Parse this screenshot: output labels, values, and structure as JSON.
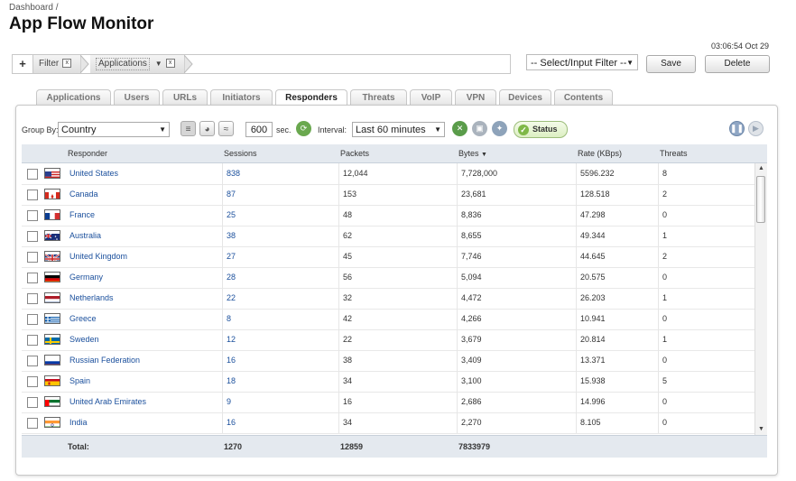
{
  "breadcrumb": "Dashboard /",
  "title": "App Flow Monitor",
  "timestamp": "03:06:54 Oct 29",
  "filter_bar": {
    "plus": "+",
    "filter_label": "Filter",
    "applications_label": "Applications",
    "close": "x",
    "chevron": "▼"
  },
  "select_filter": {
    "value": "-- Select/Input Filter --",
    "chevron": "▼"
  },
  "buttons": {
    "save": "Save",
    "delete": "Delete"
  },
  "tabs": [
    {
      "label": "Applications",
      "active": false
    },
    {
      "label": "Users",
      "active": false
    },
    {
      "label": "URLs",
      "active": false
    },
    {
      "label": "Initiators",
      "active": false
    },
    {
      "label": "Responders",
      "active": true
    },
    {
      "label": "Threats",
      "active": false
    },
    {
      "label": "VoIP",
      "active": false
    },
    {
      "label": "VPN",
      "active": false
    },
    {
      "label": "Devices",
      "active": false
    },
    {
      "label": "Contents",
      "active": false
    }
  ],
  "toolbar": {
    "group_by_label": "Group By:",
    "group_by_value": "Country",
    "group_by_chevron": "▼",
    "refresh_value": "600",
    "sec_label": "sec.",
    "interval_label": "Interval:",
    "interval_value": "Last 60 minutes",
    "interval_chevron": "▼",
    "status_label": "Status"
  },
  "table": {
    "columns": [
      "Responder",
      "Sessions",
      "Packets",
      "Bytes",
      "Rate (KBps)",
      "Threats"
    ],
    "sort_indicator": "▼",
    "rows": [
      {
        "flag": "us",
        "responder": "United States",
        "sessions": "838",
        "packets": "12,044",
        "bytes": "7,728,000",
        "rate": "5596.232",
        "threats": "8"
      },
      {
        "flag": "ca",
        "responder": "Canada",
        "sessions": "87",
        "packets": "153",
        "bytes": "23,681",
        "rate": "128.518",
        "threats": "2"
      },
      {
        "flag": "fr",
        "responder": "France",
        "sessions": "25",
        "packets": "48",
        "bytes": "8,836",
        "rate": "47.298",
        "threats": "0"
      },
      {
        "flag": "au",
        "responder": "Australia",
        "sessions": "38",
        "packets": "62",
        "bytes": "8,655",
        "rate": "49.344",
        "threats": "1"
      },
      {
        "flag": "gb",
        "responder": "United Kingdom",
        "sessions": "27",
        "packets": "45",
        "bytes": "7,746",
        "rate": "44.645",
        "threats": "2"
      },
      {
        "flag": "de",
        "responder": "Germany",
        "sessions": "28",
        "packets": "56",
        "bytes": "5,094",
        "rate": "20.575",
        "threats": "0"
      },
      {
        "flag": "nl",
        "responder": "Netherlands",
        "sessions": "22",
        "packets": "32",
        "bytes": "4,472",
        "rate": "26.203",
        "threats": "1"
      },
      {
        "flag": "gr",
        "responder": "Greece",
        "sessions": "8",
        "packets": "42",
        "bytes": "4,266",
        "rate": "10.941",
        "threats": "0"
      },
      {
        "flag": "se",
        "responder": "Sweden",
        "sessions": "12",
        "packets": "22",
        "bytes": "3,679",
        "rate": "20.814",
        "threats": "1"
      },
      {
        "flag": "ru",
        "responder": "Russian Federation",
        "sessions": "16",
        "packets": "38",
        "bytes": "3,409",
        "rate": "13.371",
        "threats": "0"
      },
      {
        "flag": "es",
        "responder": "Spain",
        "sessions": "18",
        "packets": "34",
        "bytes": "3,100",
        "rate": "15.938",
        "threats": "5"
      },
      {
        "flag": "ae",
        "responder": "United Arab Emirates",
        "sessions": "9",
        "packets": "16",
        "bytes": "2,686",
        "rate": "14.996",
        "threats": "0"
      },
      {
        "flag": "in",
        "responder": "India",
        "sessions": "16",
        "packets": "34",
        "bytes": "2,270",
        "rate": "8.105",
        "threats": "0"
      }
    ],
    "total": {
      "label": "Total:",
      "sessions": "1270",
      "packets": "12859",
      "bytes": "7833979"
    }
  },
  "colors": {
    "link": "#1a4f9c",
    "header_bg": "#e4e9ef",
    "status_green": "#7fb848"
  }
}
